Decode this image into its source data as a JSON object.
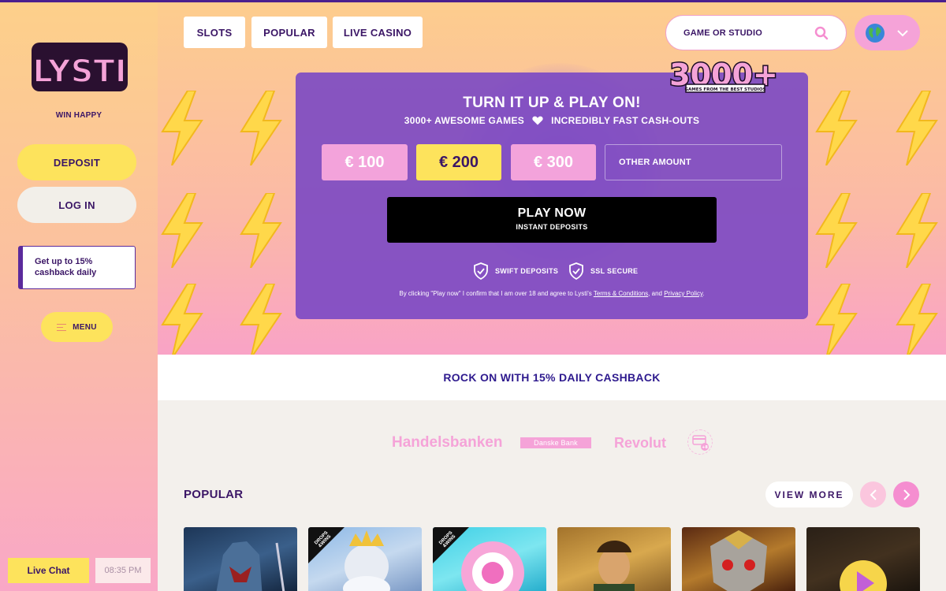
{
  "brand": {
    "logo_text": "LYSTI",
    "tagline": "WIN HAPPY"
  },
  "sidebar": {
    "deposit_label": "DEPOSIT",
    "login_label": "LOG IN",
    "cashback_line1": "Get up to 15%",
    "cashback_line2": "cashback daily",
    "menu_label": "MENU",
    "live_chat_label": "Live Chat",
    "clock": "08:35 PM"
  },
  "nav": {
    "items": [
      {
        "label": "SLOTS"
      },
      {
        "label": "POPULAR"
      },
      {
        "label": "LIVE CASINO"
      }
    ]
  },
  "search": {
    "placeholder": "GAME OR STUDIO",
    "icon": "search-icon"
  },
  "language": {
    "icon": "globe-icon"
  },
  "badge": {
    "big": "3000+",
    "small": "GAMES FROM THE BEST STUDIOS"
  },
  "hero": {
    "title": "TURN IT UP & PLAY ON!",
    "sub_left": "3000+ AWESOME GAMES",
    "sub_right": "INCREDIBLY FAST CASH-OUTS",
    "amounts": [
      {
        "label": "€ 100"
      },
      {
        "label": "€ 200"
      },
      {
        "label": "€ 300"
      }
    ],
    "other_amount": "OTHER AMOUNT",
    "play_label": "PLAY NOW",
    "play_sub": "INSTANT DEPOSITS",
    "swift": "SWIFT DEPOSITS",
    "ssl": "SSL SECURE",
    "consent_pre": "By clicking \"Play now\" I confirm that I am over 18 and agree to Lysti's ",
    "consent_terms": "Terms & Conditions",
    "consent_mid": ", and ",
    "consent_privacy": "Privacy Policy",
    "consent_end": "."
  },
  "cashback_strip": "ROCK ON WITH 15% DAILY CASHBACK",
  "payments": {
    "p1": "Handelsbanken",
    "p2": "Danske Bank",
    "p3": "Revolut",
    "more": "+8"
  },
  "popular": {
    "title": "POPULAR",
    "view_more": "VIEW MORE",
    "tile_badge_l1": "DROPS",
    "tile_badge_l2": "&WINS"
  },
  "colors": {
    "accent_purple": "#3b1666",
    "yellow": "#fde35c",
    "pink": "#f5a3d8"
  }
}
